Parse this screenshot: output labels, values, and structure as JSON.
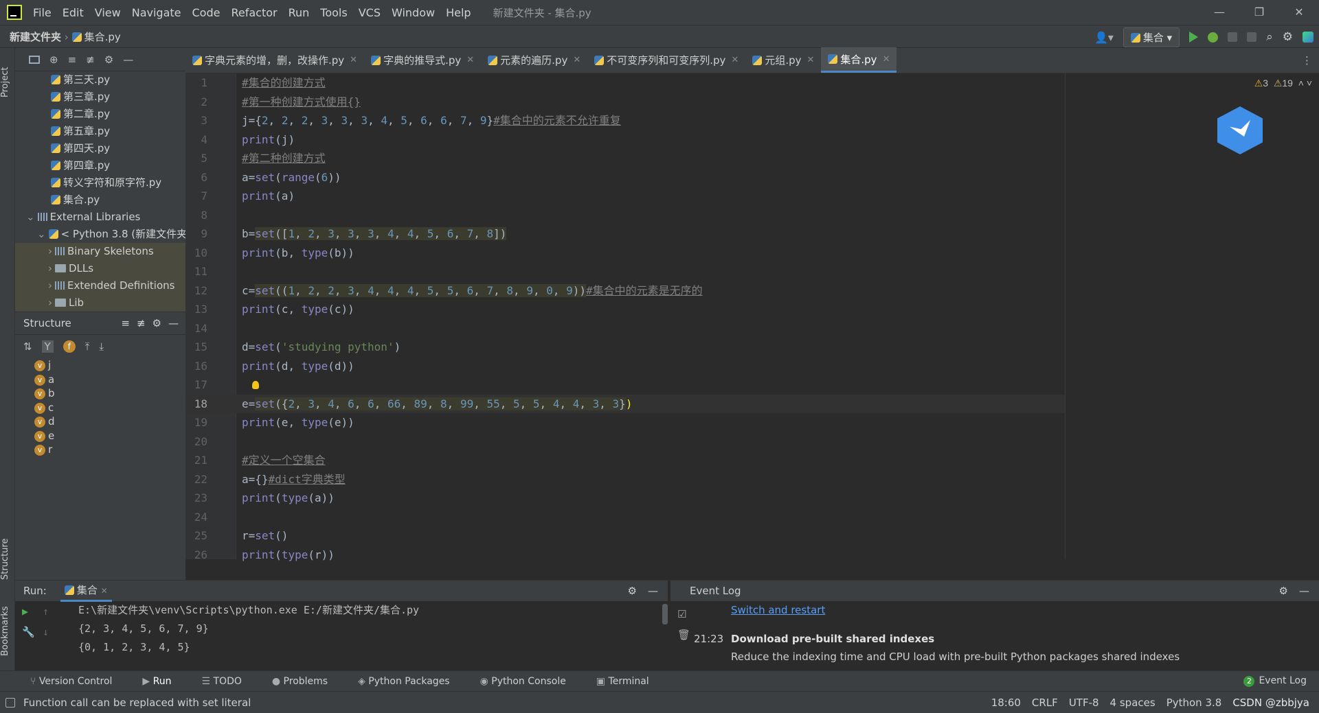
{
  "menu": {
    "items": [
      "File",
      "Edit",
      "View",
      "Navigate",
      "Code",
      "Refactor",
      "Run",
      "Tools",
      "VCS",
      "Window",
      "Help"
    ],
    "window_title": "新建文件夹 - 集合.py",
    "minimize": "—",
    "restore": "❐",
    "close": "✕"
  },
  "nav": {
    "project": "新建文件夹",
    "file": "集合.py",
    "run_config": "集合"
  },
  "project_tree": [
    {
      "label": "第三天.py",
      "indent": 3
    },
    {
      "label": "第三章.py",
      "indent": 3
    },
    {
      "label": "第二章.py",
      "indent": 3
    },
    {
      "label": "第五章.py",
      "indent": 3
    },
    {
      "label": "第四天.py",
      "indent": 3
    },
    {
      "label": "第四章.py",
      "indent": 3
    },
    {
      "label": "转义字符和原字符.py",
      "indent": 3
    },
    {
      "label": "集合.py",
      "indent": 3
    },
    {
      "label": "External Libraries",
      "indent": 1
    },
    {
      "label": "< Python 3.8 (新建文件夹",
      "indent": 2
    },
    {
      "label": "Binary Skeletons",
      "indent": 3
    },
    {
      "label": "DLLs",
      "indent": 3
    },
    {
      "label": "Extended Definitions",
      "indent": 3
    },
    {
      "label": "Lib",
      "indent": 3
    }
  ],
  "structure": {
    "title": "Structure",
    "vars": [
      "j",
      "a",
      "b",
      "c",
      "d",
      "e",
      "r"
    ],
    "badge": "v"
  },
  "tabs": [
    {
      "label": "字典元素的增，删，改操作.py",
      "active": false
    },
    {
      "label": "字典的推导式.py",
      "active": false
    },
    {
      "label": "元素的遍历.py",
      "active": false
    },
    {
      "label": "不可变序列和可变序列.py",
      "active": false
    },
    {
      "label": "元组.py",
      "active": false
    },
    {
      "label": "集合.py",
      "active": true
    }
  ],
  "editor": {
    "warnings_a": "3",
    "warnings_b": "19",
    "current_line": 18,
    "lines": [
      {
        "n": "1",
        "html": "<span class='cmt'>#集合的创建方式</span>"
      },
      {
        "n": "2",
        "html": "<span class='cmt'>#第一种创建方式使用{}</span>"
      },
      {
        "n": "3",
        "html": "j={<span class='num'>2</span>, <span class='num'>2</span>, <span class='num'>2</span>, <span class='num'>3</span>, <span class='num'>3</span>, <span class='num'>3</span>, <span class='num'>4</span>, <span class='num'>5</span>, <span class='num'>6</span>, <span class='num'>6</span>, <span class='num'>7</span>, <span class='num'>9</span>}<span class='cmt'>#集合中的元素不允许重复</span>"
      },
      {
        "n": "4",
        "html": "<span class='kw'>print</span>(j)"
      },
      {
        "n": "5",
        "html": "<span class='cmt'>#第二种创建方式</span>"
      },
      {
        "n": "6",
        "html": "a=<span class='kw'>set</span>(<span class='kw'>range</span>(<span class='num'>6</span>))"
      },
      {
        "n": "7",
        "html": "<span class='kw'>print</span>(a)"
      },
      {
        "n": "8",
        "html": ""
      },
      {
        "n": "9",
        "html": "b=<span class='hl'><span class='kw'>set</span>([<span class='num'>1</span>, <span class='num'>2</span>, <span class='num'>3</span>, <span class='num'>3</span>, <span class='num'>3</span>, <span class='num'>4</span>, <span class='num'>4</span>, <span class='num'>5</span>, <span class='num'>6</span>, <span class='num'>7</span>, <span class='num'>8</span>])</span>"
      },
      {
        "n": "10",
        "html": "<span class='kw'>print</span>(b, <span class='kw'>type</span>(b))"
      },
      {
        "n": "11",
        "html": ""
      },
      {
        "n": "12",
        "html": "c=<span class='hl'><span class='kw'>set</span>((<span class='num'>1</span>, <span class='num'>2</span>, <span class='num'>2</span>, <span class='num'>3</span>, <span class='num'>4</span>, <span class='num'>4</span>, <span class='num'>4</span>, <span class='num'>5</span>, <span class='num'>5</span>, <span class='num'>6</span>, <span class='num'>7</span>, <span class='num'>8</span>, <span class='num'>9</span>, <span class='num'>0</span>, <span class='num'>9</span>))</span><span class='cmt'>#集合中的元素是无序的</span>"
      },
      {
        "n": "13",
        "html": "<span class='kw'>print</span>(c, <span class='kw'>type</span>(c))"
      },
      {
        "n": "14",
        "html": ""
      },
      {
        "n": "15",
        "html": "d=<span class='kw'>set</span>(<span class='str'>'studying python'</span>)"
      },
      {
        "n": "16",
        "html": "<span class='kw'>print</span>(d, <span class='kw'>type</span>(d))"
      },
      {
        "n": "17",
        "html": ""
      },
      {
        "n": "18",
        "html": "e=<span class='hl'><span class='kw'>set</span>({<span class='num'>2</span>, <span class='num'>3</span>, <span class='num'>4</span>, <span class='num'>6</span>, <span class='num'>6</span>, <span class='num'>66</span>, <span class='num'>89</span>, <span class='num'>8</span>, <span class='num'>99</span>, <span class='num'>55</span>, <span class='num'>5</span>, <span class='num'>5</span>, <span class='num'>4</span>, <span class='num'>4</span>, <span class='num'>3</span>, <span class='num'>3</span>}</span><span style='color:#ffef28'>)</span>"
      },
      {
        "n": "19",
        "html": "<span class='kw'>print</span>(e, <span class='kw'>type</span>(e))"
      },
      {
        "n": "20",
        "html": ""
      },
      {
        "n": "21",
        "html": "<span class='cmt'>#定义一个空集合</span>"
      },
      {
        "n": "22",
        "html": "a={}<span class='cmt'>#dict字典类型</span>"
      },
      {
        "n": "23",
        "html": "<span class='kw'>print</span>(<span class='kw'>type</span>(a))"
      },
      {
        "n": "24",
        "html": ""
      },
      {
        "n": "25",
        "html": "r=<span class='kw'>set</span>()"
      },
      {
        "n": "26",
        "html": "<span class='kw'>print</span>(<span class='kw'>type</span>(r))"
      }
    ]
  },
  "run": {
    "label": "Run:",
    "tab": "集合",
    "output": [
      "E:\\新建文件夹\\venv\\Scripts\\python.exe E:/新建文件夹/集合.py",
      "{2, 3, 4, 5, 6, 7, 9}",
      "{0, 1, 2, 3, 4, 5}"
    ]
  },
  "event_log": {
    "title": "Event Log",
    "link": "Switch and restart",
    "time": "21:23",
    "headline": "Download pre-built shared indexes",
    "body": "Reduce the indexing time and CPU load with pre-built Python packages shared indexes"
  },
  "toolwindows": [
    "Version Control",
    "Run",
    "TODO",
    "Problems",
    "Python Packages",
    "Python Console",
    "Terminal"
  ],
  "event_log_button": "Event Log",
  "event_log_count": "2",
  "status": {
    "message": "Function call can be replaced with set literal",
    "position": "18:60",
    "line_sep": "CRLF",
    "encoding": "UTF-8",
    "indent": "4 spaces",
    "interpreter": "Python 3.8",
    "watermark": "CSDN @zbbjya"
  },
  "side_tabs": {
    "project": "Project",
    "structure": "Structure",
    "bookmarks": "Bookmarks"
  }
}
